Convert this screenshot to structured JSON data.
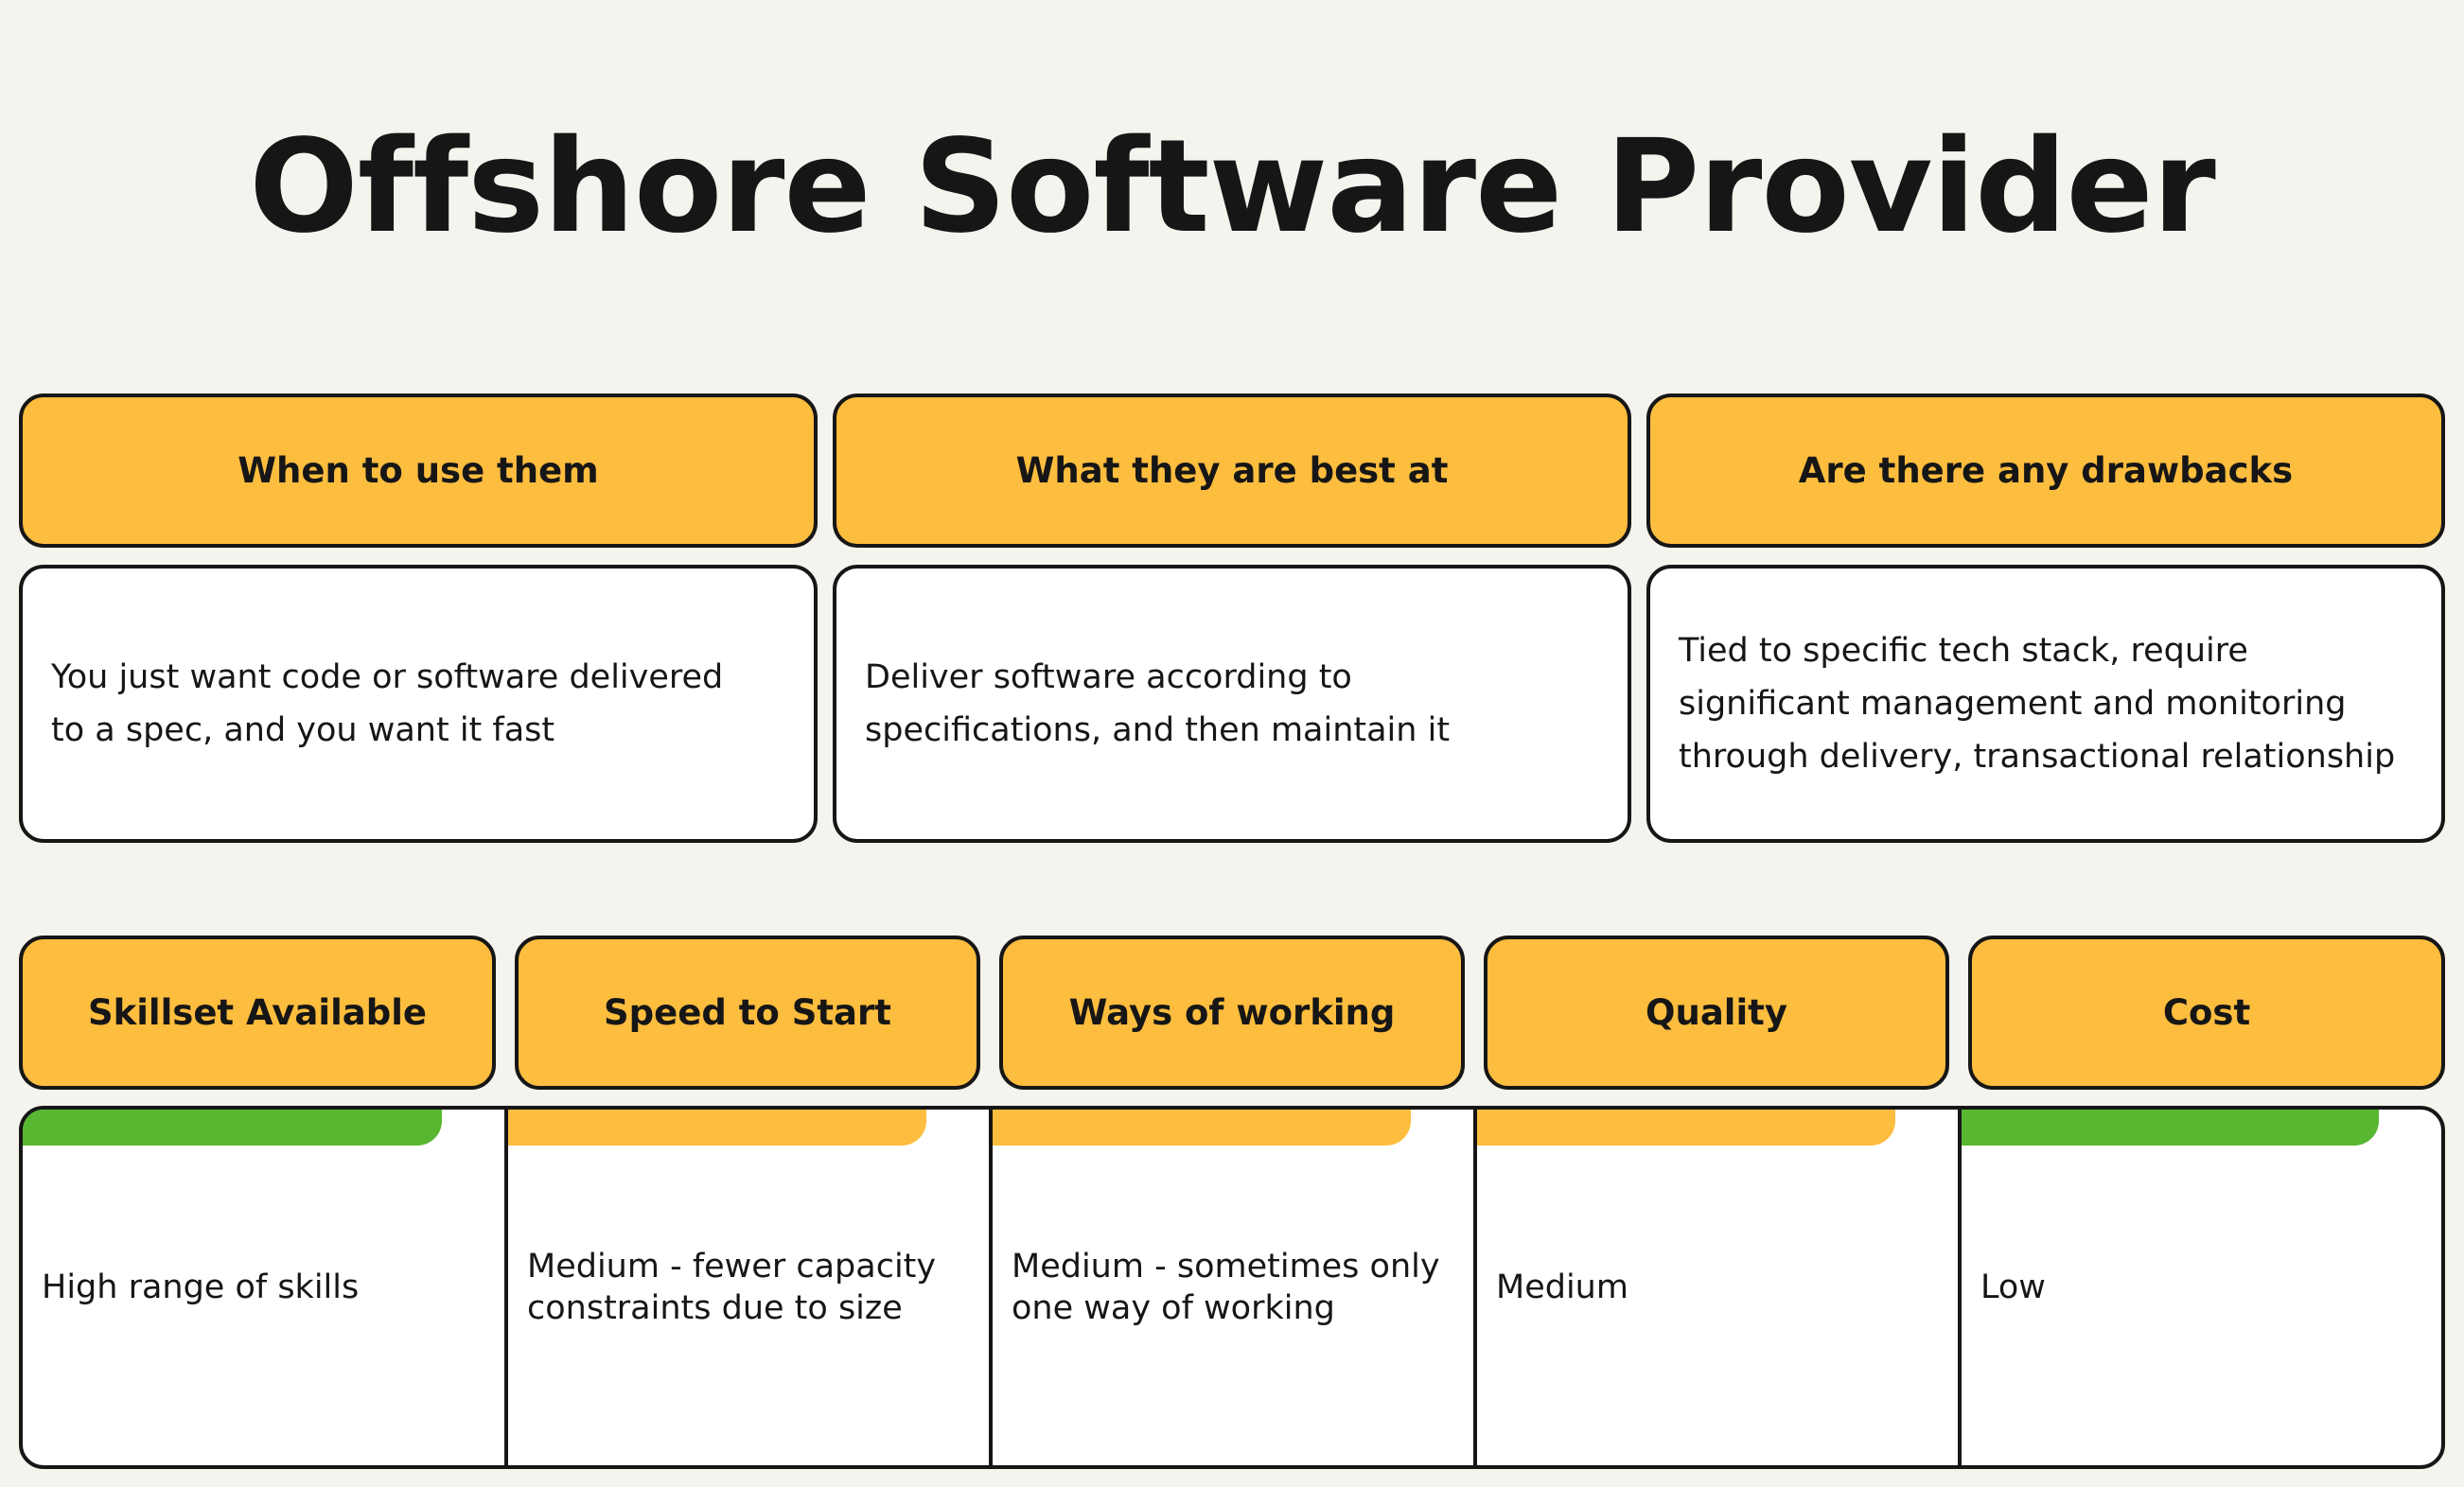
{
  "title": "Offshore Software Provider",
  "top_sections": [
    {
      "heading": "When to use them",
      "text": "You just want code or software delivered to a spec, and you want it fast"
    },
    {
      "heading": "What they are best at",
      "text": "Deliver software according to specifications, and then maintain it"
    },
    {
      "heading": "Are there any drawbacks",
      "text": "Tied to specific tech stack, require significant management and monitoring through delivery, transactional relationship"
    }
  ],
  "criteria": [
    {
      "heading": "Skillset Available",
      "value": "High range of skills",
      "rating_color": "#58b730"
    },
    {
      "heading": "Speed to Start",
      "value": "Medium - fewer capacity constraints due to size",
      "rating_color": "#fdbd3e"
    },
    {
      "heading": "Ways of working",
      "value": "Medium - sometimes only one way of working",
      "rating_color": "#fdbd3e"
    },
    {
      "heading": "Quality",
      "value": "Medium",
      "rating_color": "#fdbd3e"
    },
    {
      "heading": "Cost",
      "value": "Low",
      "rating_color": "#58b730"
    }
  ]
}
